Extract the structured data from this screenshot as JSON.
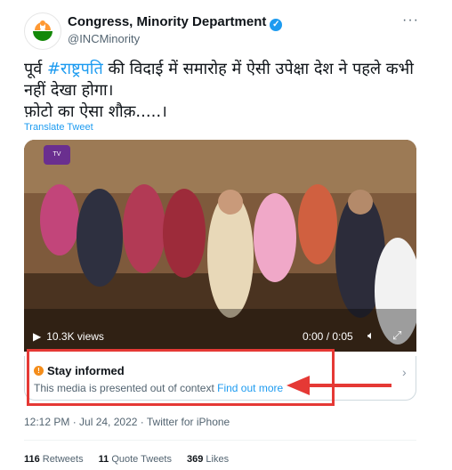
{
  "tweet": {
    "author": {
      "name": "Congress, Minority Department",
      "handle": "@INCMinority"
    },
    "text_prefix": "पूर्व ",
    "hashtag": "#राष्ट्रपति",
    "text_rest": " की विदाई में समारोह में ऐसी उपेक्षा  देश ने पहले कभी नहीं देखा होगा।\nफ़ोटो का ऐसा शौक़.....।",
    "translate_label": "Translate Tweet",
    "media": {
      "views": "10.3K views",
      "timecode": "0:00 / 0:05"
    },
    "notice": {
      "title": "Stay informed",
      "body": "This media is presented out of context",
      "link": "Find out more"
    },
    "timestamp": "12:12 PM · Jul 24, 2022 · Twitter for iPhone",
    "stats": {
      "retweets_count": "116",
      "retweets_label": "Retweets",
      "quotes_count": "11",
      "quotes_label": "Quote Tweets",
      "likes_count": "369",
      "likes_label": "Likes"
    }
  },
  "colors": {
    "link": "#1d9bf0",
    "annotation": "#e53935",
    "warning": "#f48d1b"
  },
  "icons": [
    "verified-icon",
    "more-icon",
    "play-icon",
    "volume-icon",
    "fullscreen-icon",
    "info-icon",
    "chevron-right-icon",
    "arrow-left-icon"
  ]
}
